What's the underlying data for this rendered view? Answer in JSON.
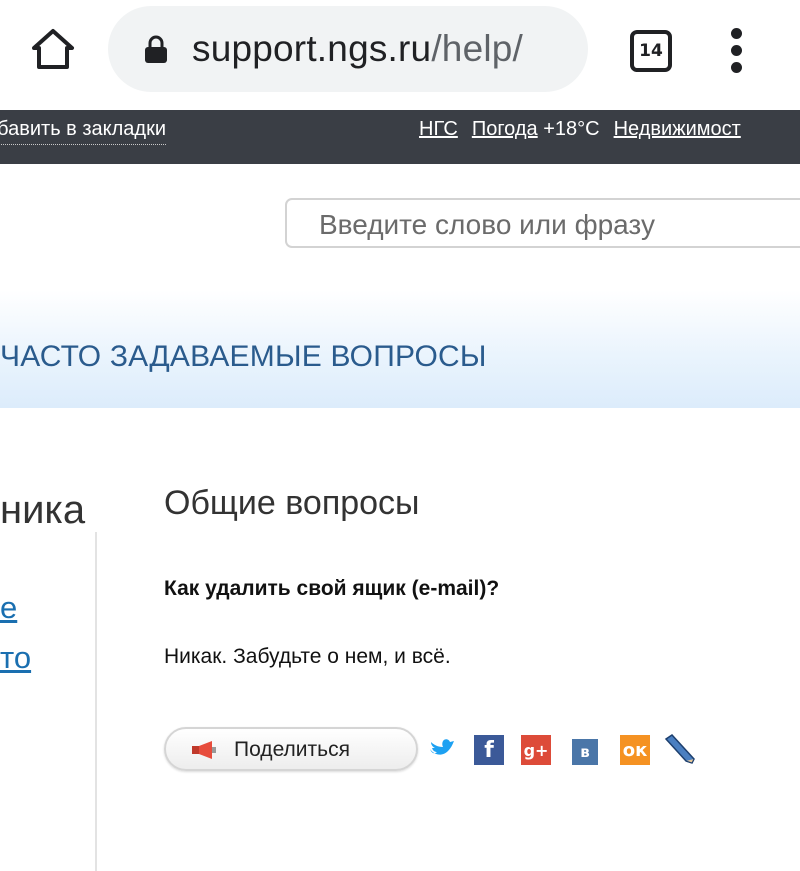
{
  "browser": {
    "url_host": "support.ngs.ru",
    "url_path": "/help/",
    "tab_count": "14"
  },
  "topbar": {
    "bookmark_label": "обавить в закладки",
    "nav": [
      {
        "label": "НГС"
      },
      {
        "label": "Погода"
      },
      {
        "label": "Недвижимост"
      }
    ],
    "temperature": "+18°C"
  },
  "search": {
    "placeholder": "Введите слово или фразу"
  },
  "faq": {
    "title": "ЧАСТО ЗАДАВАЕМЫЕ ВОПРОСЫ"
  },
  "left_column": {
    "heading_fragment": "ника",
    "link_fragments": [
      "е",
      "то"
    ]
  },
  "main": {
    "section_title": "Общие вопросы",
    "question": "Как удалить свой ящик (e-mail)?",
    "answer": "Никак. Забудьте о нем, и всё."
  },
  "share": {
    "label": "Поделиться",
    "networks": [
      "twitter-icon",
      "facebook-icon",
      "google-plus-icon",
      "vkontakte-icon",
      "odnoklassniki-icon",
      "livejournal-icon"
    ]
  },
  "colors": {
    "topbar_bg": "#3a3e45",
    "faq_title": "#2a5b8d",
    "link": "#1a6fb0",
    "facebook": "#3b5998",
    "google_plus": "#dd4b39",
    "vkontakte": "#4a76a8",
    "odnoklassniki": "#f59222"
  }
}
